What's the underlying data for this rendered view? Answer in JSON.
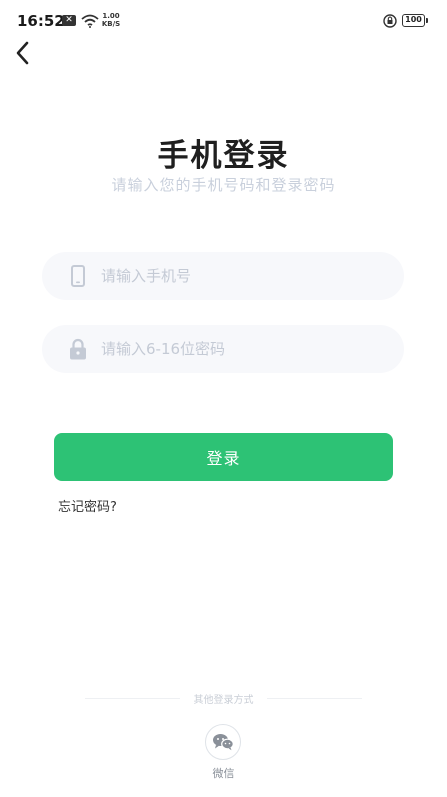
{
  "status_bar": {
    "time": "16:52",
    "notification_badge": "✕",
    "net_speed_value": "1.00",
    "net_speed_unit": "KB/S",
    "battery": "100"
  },
  "header": {
    "back_icon": "chevron-left-icon"
  },
  "title": "手机登录",
  "subtitle": "请输入您的手机号码和登录密码",
  "phone_field": {
    "placeholder": "请输入手机号",
    "value": "",
    "icon": "phone-icon"
  },
  "password_field": {
    "placeholder": "请输入6-16位密码",
    "value": "",
    "icon": "lock-icon"
  },
  "login_button": "登录",
  "forgot_password": "忘记密码?",
  "other_login": {
    "label": "其他登录方式",
    "wechat_label": "微信",
    "wechat_icon": "wechat-icon"
  },
  "colors": {
    "primary": "#2dc275",
    "input_bg": "#f7f8fb",
    "placeholder": "#c4cad5"
  }
}
